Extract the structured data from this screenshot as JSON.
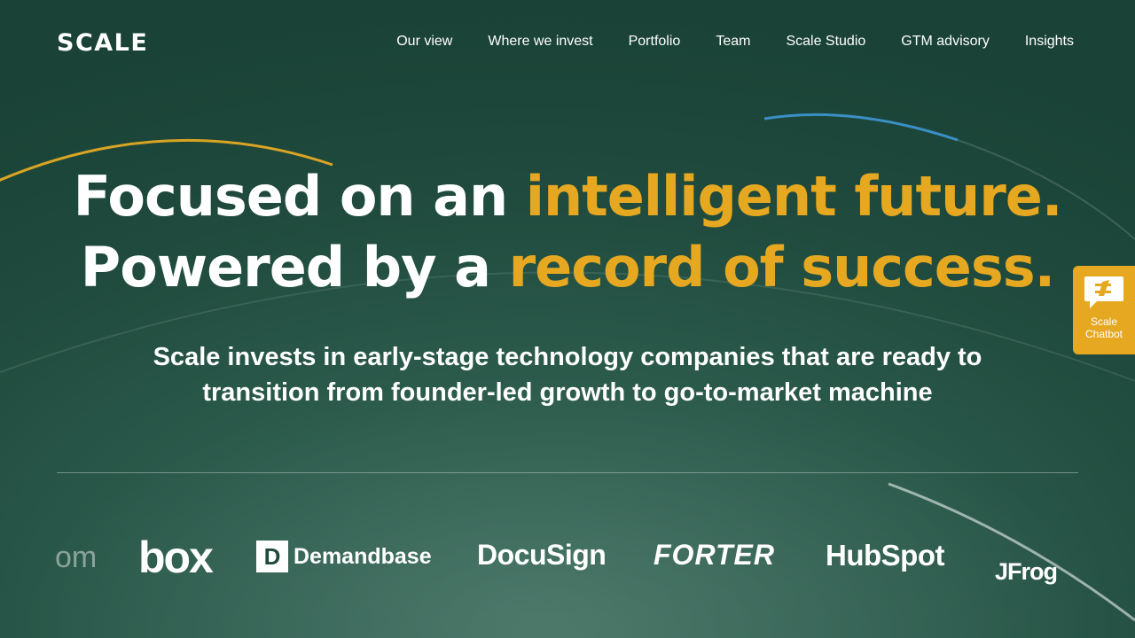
{
  "nav": {
    "logo": "SCALE",
    "items": [
      "Our view",
      "Where we invest",
      "Portfolio",
      "Team",
      "Scale Studio",
      "GTM advisory",
      "Insights"
    ]
  },
  "hero": {
    "line1_white": "Focused on an ",
    "line1_accent": "intelligent future.",
    "line2_white": "Powered by a ",
    "line2_accent": "record of success."
  },
  "subheadline": {
    "line1": "Scale invests in early-stage technology companies that are ready to",
    "line2": "transition from founder-led growth to go-to-market machine"
  },
  "logos": {
    "partial": "om",
    "box": "box",
    "demandbase_mark": "D",
    "demandbase": "Demandbase",
    "docusign": "DocuSign",
    "forter": "FORTER",
    "hubspot": "HubSpot",
    "jfrog": "JFrog"
  },
  "chatbot": {
    "label_line1": "Scale",
    "label_line2": "Chatbot",
    "icon": "chat-icon"
  },
  "colors": {
    "accent": "#e6a821",
    "background": "#1d4a3c",
    "arc_blue": "#3a8fc4"
  }
}
